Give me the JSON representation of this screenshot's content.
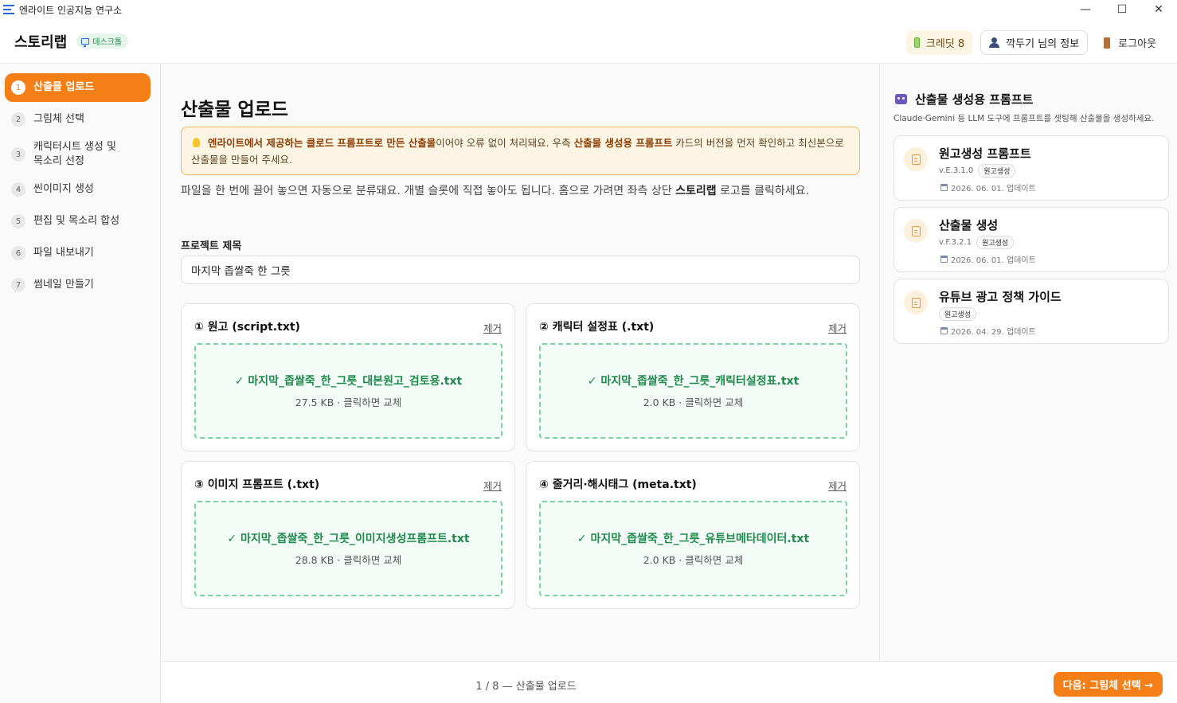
{
  "window": {
    "title": "엔라이트 인공지능 연구소",
    "minimize": "—",
    "maximize": "☐",
    "close": "✕"
  },
  "header": {
    "logo": "스토리랩",
    "badge": "데스크톱",
    "credit": "크레딧 8",
    "user_info": "깍두기 님의 정보",
    "logout": "로그아웃"
  },
  "sidebar": {
    "items": [
      {
        "num": "1",
        "label": "산출물 업로드",
        "active": true
      },
      {
        "num": "2",
        "label": "그림체 선택"
      },
      {
        "num": "3",
        "label": "캐릭터시트 생성 및 목소리 선정"
      },
      {
        "num": "4",
        "label": "씬이미지 생성"
      },
      {
        "num": "5",
        "label": "편집 및 목소리 합성"
      },
      {
        "num": "6",
        "label": "파일 내보내기"
      },
      {
        "num": "7",
        "label": "썸네일 만들기"
      }
    ]
  },
  "main": {
    "title": "산출물 업로드",
    "notice": {
      "p1": "엔라이트에서 제공하는 클로드 프롬프트로 만든 산출물",
      "p2": "이어야 오류 없이 처리돼요. 우측 ",
      "p3": "산출물 생성용 프롬프트",
      "p4": " 카드의 버전을 먼저 확인하고 최신본으로 산출물을 만들어 주세요."
    },
    "desc": {
      "p1": "파일을 한 번에 끌어 놓으면 자동으로 분류돼요. 개별 슬롯에 직접 놓아도 됩니다. 홈으로 가려면 좌측 상단 ",
      "p2": "스토리랩",
      "p3": " 로고를 클릭하세요."
    },
    "project_label": "프로젝트 제목",
    "project_value": "마지막 좁쌀죽 한 그릇",
    "slots": [
      {
        "title": "① 원고 (script.txt)",
        "remove": "제거",
        "file": "✓ 마지막_좁쌀죽_한_그릇_대본원고_검토용.txt",
        "meta": "27.5 KB · 클릭하면 교체"
      },
      {
        "title": "② 캐릭터 설정표 (.txt)",
        "remove": "제거",
        "file": "✓ 마지막_좁쌀죽_한_그릇_캐릭터설정표.txt",
        "meta": "2.0 KB · 클릭하면 교체"
      },
      {
        "title": "③ 이미지 프롬프트 (.txt)",
        "remove": "제거",
        "file": "✓ 마지막_좁쌀죽_한_그릇_이미지생성프롬프트.txt",
        "meta": "28.8 KB · 클릭하면 교체"
      },
      {
        "title": "④ 줄거리·해시태그 (meta.txt)",
        "remove": "제거",
        "file": "✓ 마지막_좁쌀죽_한_그릇_유튜브메타데이터.txt",
        "meta": "2.0 KB · 클릭하면 교체"
      }
    ]
  },
  "right_panel": {
    "title": "산출물 생성용 프롬프트",
    "subtitle": "Claude·Gemini 등 LLM 도구에 프롬프트를 셋팅해 산출물을 생성하세요.",
    "cards": [
      {
        "name": "원고생성 프롬프트",
        "version": "v.E.3.1.0",
        "tag": "원고생성",
        "date": "2026. 06. 01. 업데이트"
      },
      {
        "name": "산출물 생성",
        "version": "v.F.3.2.1",
        "tag": "원고생성",
        "date": "2026. 06. 01. 업데이트"
      },
      {
        "name": "유튜브 광고 정책 가이드",
        "version": "",
        "tag": "원고생성",
        "date": "2026. 04. 29. 업데이트"
      }
    ]
  },
  "footer": {
    "progress": "1 / 8 — 산출물 업로드",
    "next": "다음: 그림체 선택 →"
  }
}
